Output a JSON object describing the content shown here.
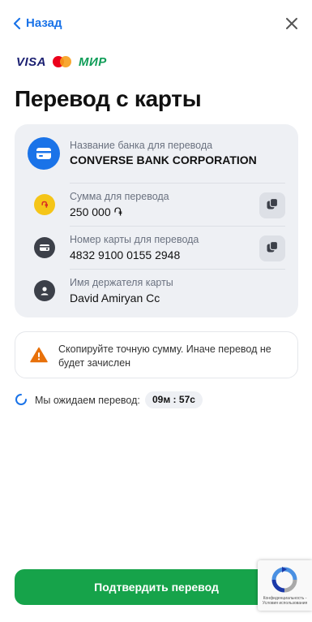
{
  "header": {
    "back_label": "Назад"
  },
  "payment_systems": {
    "visa": "VISA",
    "mir": "МИР"
  },
  "title": "Перевод с карты",
  "details": {
    "bank": {
      "label": "Название банка для перевода",
      "value": "CONVERSE BANK CORPORATION"
    },
    "amount": {
      "label": "Сумма для перевода",
      "value": "250 000 ֏"
    },
    "card_number": {
      "label": "Номер карты для перевода",
      "value": "4832 9100 0155 2948"
    },
    "holder": {
      "label": "Имя держателя карты",
      "value": "David Amiryan Cc"
    }
  },
  "warning": {
    "text": "Скопируйте точную сумму. Иначе перевод не будет зачислен"
  },
  "waiting": {
    "label": "Мы ожидаем перевод:",
    "timer": "09м : 57с"
  },
  "confirm_label": "Подтвердить перевод",
  "recaptcha": {
    "text": "Конфиденциальность - Условия использования"
  },
  "colors": {
    "accent": "#1a73e8",
    "confirm": "#16a34a",
    "warning": "#e8710a",
    "amount_icon": "#f5c518"
  }
}
